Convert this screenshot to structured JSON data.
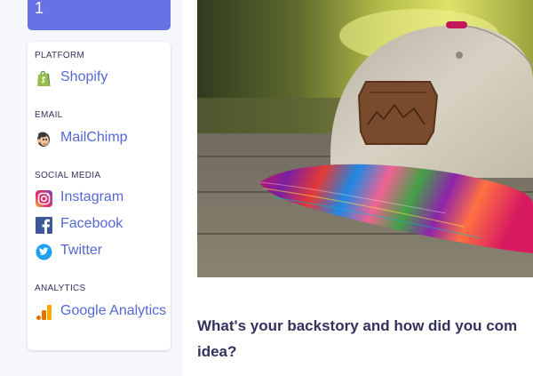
{
  "banner": {
    "number": "1"
  },
  "sidebar": {
    "sections": [
      {
        "heading": "PLATFORM",
        "items": [
          {
            "label": "Shopify",
            "icon": "shopify-icon"
          }
        ]
      },
      {
        "heading": "EMAIL",
        "items": [
          {
            "label": "MailChimp",
            "icon": "mailchimp-icon"
          }
        ]
      },
      {
        "heading": "SOCIAL MEDIA",
        "items": [
          {
            "label": "Instagram",
            "icon": "instagram-icon"
          },
          {
            "label": "Facebook",
            "icon": "facebook-icon"
          },
          {
            "label": "Twitter",
            "icon": "twitter-icon"
          }
        ]
      },
      {
        "heading": "ANALYTICS",
        "items": [
          {
            "label": "Google Analytics",
            "icon": "google-analytics-icon"
          }
        ]
      }
    ]
  },
  "article": {
    "question_line1": "What's your backstory and how did you com",
    "question_line2": "idea?"
  },
  "colors": {
    "accent": "#6772e5",
    "link": "#5469d4",
    "heading_text": "#32325d",
    "sidebar_bg": "#f5f7fb"
  }
}
